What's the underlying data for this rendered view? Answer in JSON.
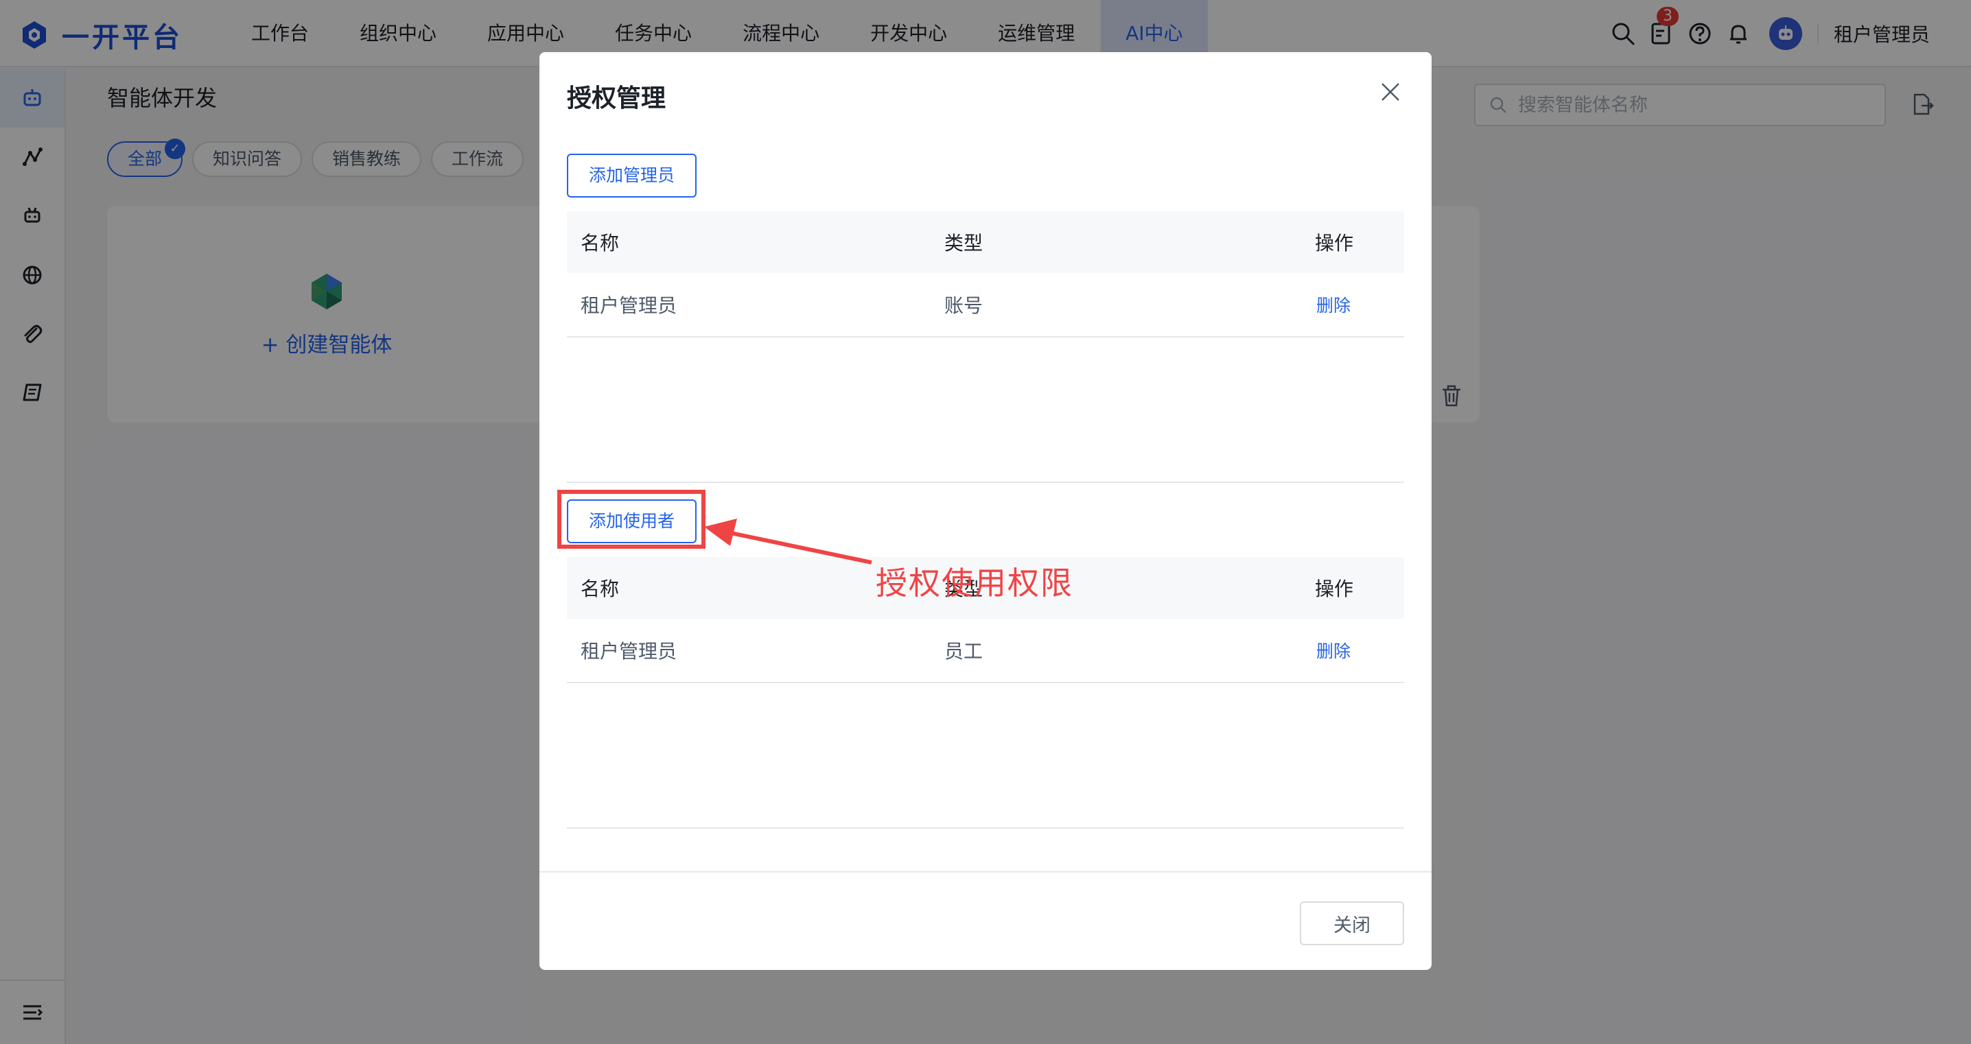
{
  "brand": {
    "name": "一开平台",
    "accent": "#2563eb"
  },
  "nav": {
    "items": [
      {
        "label": "工作台"
      },
      {
        "label": "组织中心"
      },
      {
        "label": "应用中心"
      },
      {
        "label": "任务中心"
      },
      {
        "label": "流程中心"
      },
      {
        "label": "开发中心"
      },
      {
        "label": "运维管理"
      },
      {
        "label": "AI中心",
        "active": true
      }
    ]
  },
  "header": {
    "notification_count": "3",
    "user_name": "租户管理员",
    "icons": [
      "search-icon",
      "todo-icon",
      "help-icon",
      "bell-icon"
    ]
  },
  "sidebar": {
    "icons": [
      "robot-icon",
      "workflow-icon",
      "bot-icon",
      "globe-icon",
      "paperclip-icon",
      "book-icon"
    ],
    "collapse_icon": "collapse-icon"
  },
  "page": {
    "title": "智能体开发",
    "filters": [
      {
        "label": "全部",
        "active": true
      },
      {
        "label": "知识问答"
      },
      {
        "label": "销售教练"
      },
      {
        "label": "工作流"
      }
    ],
    "search_placeholder": "搜索智能体名称",
    "create_label": "+ 创建智能体"
  },
  "modal": {
    "title": "授权管理",
    "add_admin_label": "添加管理员",
    "admin_table": {
      "headers": {
        "name": "名称",
        "type": "类型",
        "op": "操作"
      },
      "rows": [
        {
          "name": "租户管理员",
          "type": "账号",
          "op": "删除"
        }
      ]
    },
    "add_user_label": "添加使用者",
    "user_table": {
      "headers": {
        "name": "名称",
        "type": "类型",
        "op": "操作"
      },
      "rows": [
        {
          "name": "租户管理员",
          "type": "员工",
          "op": "删除"
        }
      ]
    },
    "close_label": "关闭"
  },
  "annotation": {
    "text": "授权使用权限",
    "color": "#ef4444"
  }
}
